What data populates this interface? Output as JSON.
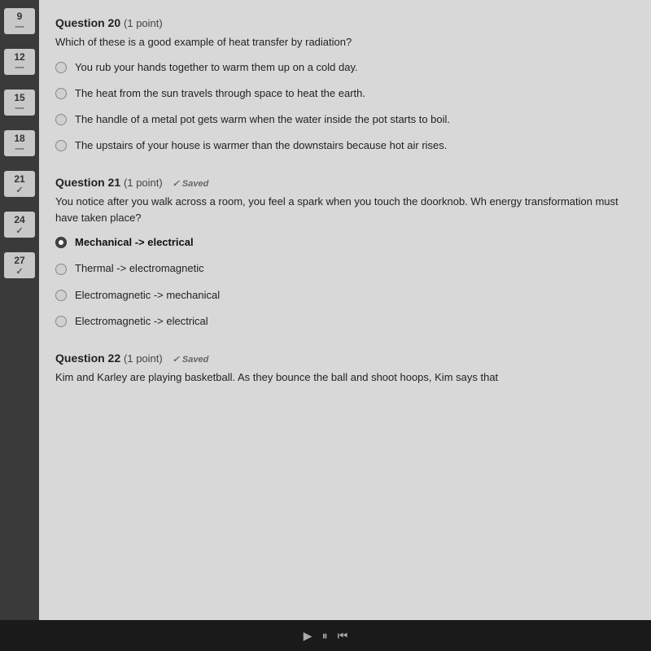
{
  "sidebar": {
    "items": [
      {
        "num": "9",
        "check": "—"
      },
      {
        "num": "12",
        "check": "—"
      },
      {
        "num": "15",
        "check": "—"
      },
      {
        "num": "18",
        "check": "—"
      },
      {
        "num": "21",
        "check": "✓"
      },
      {
        "num": "24",
        "check": "✓"
      },
      {
        "num": "27",
        "check": "✓"
      }
    ]
  },
  "questions": {
    "q20": {
      "title": "Question 20",
      "points": "(1 point)",
      "text": "Which of these is a good example of heat transfer by radiation?",
      "options": [
        {
          "id": "q20a",
          "text": "You rub your hands together to warm them up on a cold day.",
          "selected": false
        },
        {
          "id": "q20b",
          "text": "The heat from the sun travels through space to heat the earth.",
          "selected": false
        },
        {
          "id": "q20c",
          "text": "The handle of a metal pot gets warm when the water inside the pot starts to boil.",
          "selected": false
        },
        {
          "id": "q20d",
          "text": "The upstairs of your house is warmer than the downstairs because hot air rises.",
          "selected": false
        }
      ]
    },
    "q21": {
      "title": "Question 21",
      "points": "(1 point)",
      "saved_label": "✓ Saved",
      "text": "You notice after you walk across a room, you feel a spark when you touch the doorknob. Wh energy transformation must have taken place?",
      "options": [
        {
          "id": "q21a",
          "text": "Mechanical -> electrical",
          "selected": true
        },
        {
          "id": "q21b",
          "text": "Thermal -> electromagnetic",
          "selected": false
        },
        {
          "id": "q21c",
          "text": "Electromagnetic -> mechanical",
          "selected": false
        },
        {
          "id": "q21d",
          "text": "Electromagnetic -> electrical",
          "selected": false
        }
      ]
    },
    "q22": {
      "title": "Question 22",
      "points": "(1 point)",
      "saved_label": "✓ Saved",
      "text": "Kim and Karley are playing basketball. As they bounce the ball and shoot hoops, Kim says that"
    }
  }
}
